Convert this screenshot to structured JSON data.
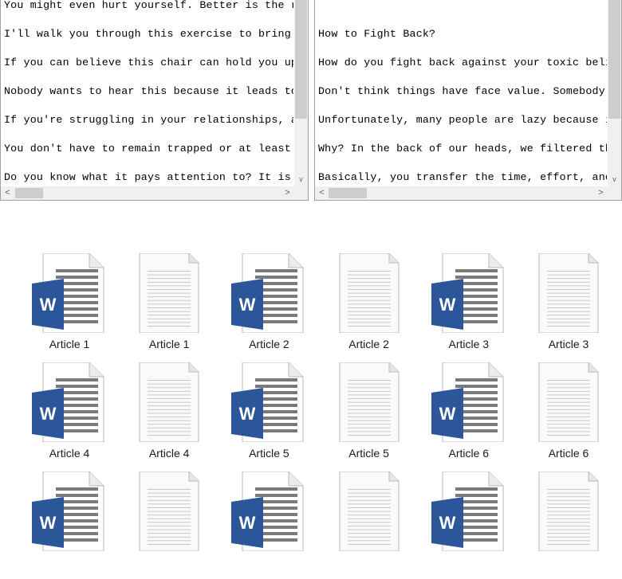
{
  "left_pane": {
    "lines": [
      "You might even hurt yourself. Better is the r",
      "I'll walk you through this exercise to bring",
      "If you can believe this chair can hold you up",
      "Nobody wants to hear this because it leads to",
      "If you're struggling in your relationships, a",
      "You don't have to remain trapped or at least",
      "Do you know what it pays attention to? It is"
    ]
  },
  "right_pane": {
    "lines": [
      "",
      "How to Fight Back?",
      "How do you fight back against your toxic beli",
      "Don't think things have face value. Somebody",
      "Unfortunately, many people are lazy because i",
      "Why? In the back of our heads, we filtered th",
      "Basically, you transfer the time, effort, and"
    ]
  },
  "scroll_glyphs": {
    "left": "<",
    "right": ">",
    "down": "v"
  },
  "files": [
    {
      "label": "Article 1",
      "type": "word"
    },
    {
      "label": "Article 1",
      "type": "text"
    },
    {
      "label": "Article 2",
      "type": "word"
    },
    {
      "label": "Article 2",
      "type": "text"
    },
    {
      "label": "Article 3",
      "type": "word"
    },
    {
      "label": "Article 3",
      "type": "text"
    },
    {
      "label": "Article 4",
      "type": "word"
    },
    {
      "label": "Article 4",
      "type": "text"
    },
    {
      "label": "Article 5",
      "type": "word"
    },
    {
      "label": "Article 5",
      "type": "text"
    },
    {
      "label": "Article 6",
      "type": "word"
    },
    {
      "label": "Article 6",
      "type": "text"
    },
    {
      "label": "",
      "type": "word"
    },
    {
      "label": "",
      "type": "text"
    },
    {
      "label": "",
      "type": "word"
    },
    {
      "label": "",
      "type": "text"
    },
    {
      "label": "",
      "type": "word"
    },
    {
      "label": "",
      "type": "text"
    }
  ],
  "colors": {
    "word_blue": "#2b579a",
    "word_lines": "#7a7a7a",
    "page_border": "#b9b9b9"
  },
  "icons": {
    "word": "word-document-icon",
    "text": "text-document-icon",
    "word_letter": "W"
  }
}
